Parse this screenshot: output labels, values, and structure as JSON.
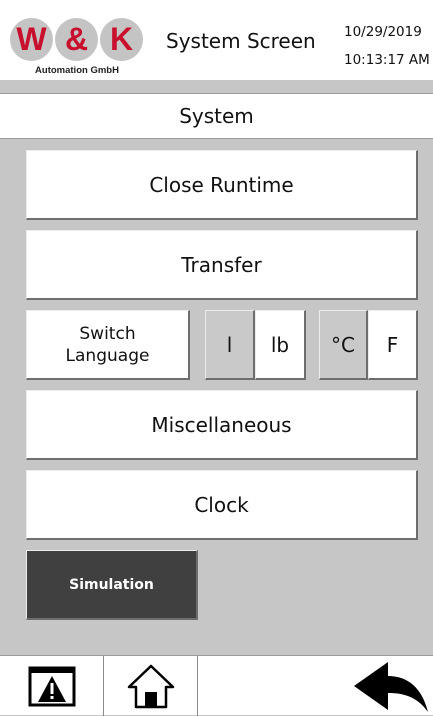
{
  "header": {
    "logo": {
      "letters": [
        "W",
        "&",
        "K"
      ],
      "company": "Automation GmbH"
    },
    "title": "System Screen",
    "date": "10/29/2019",
    "time": "10:13:17 AM"
  },
  "section": {
    "title": "System"
  },
  "buttons": {
    "close_runtime": "Close Runtime",
    "transfer": "Transfer",
    "switch_language_line1": "Switch",
    "switch_language_line2": "Language",
    "unit_liter": "l",
    "unit_pound": "lb",
    "unit_celsius": "°C",
    "unit_fahrenheit": "F",
    "miscellaneous": "Miscellaneous",
    "clock": "Clock",
    "simulation": "Simulation"
  },
  "nav": {
    "icons": [
      "alarm-warning-icon",
      "home-icon",
      "back-arrow-icon"
    ]
  },
  "colors": {
    "logo_red": "#c8102e",
    "logo_circle": "#c4c4c4",
    "background": "#c6c6c6",
    "selected_unit": "#c9c9c9",
    "simulation_button": "#404040"
  }
}
